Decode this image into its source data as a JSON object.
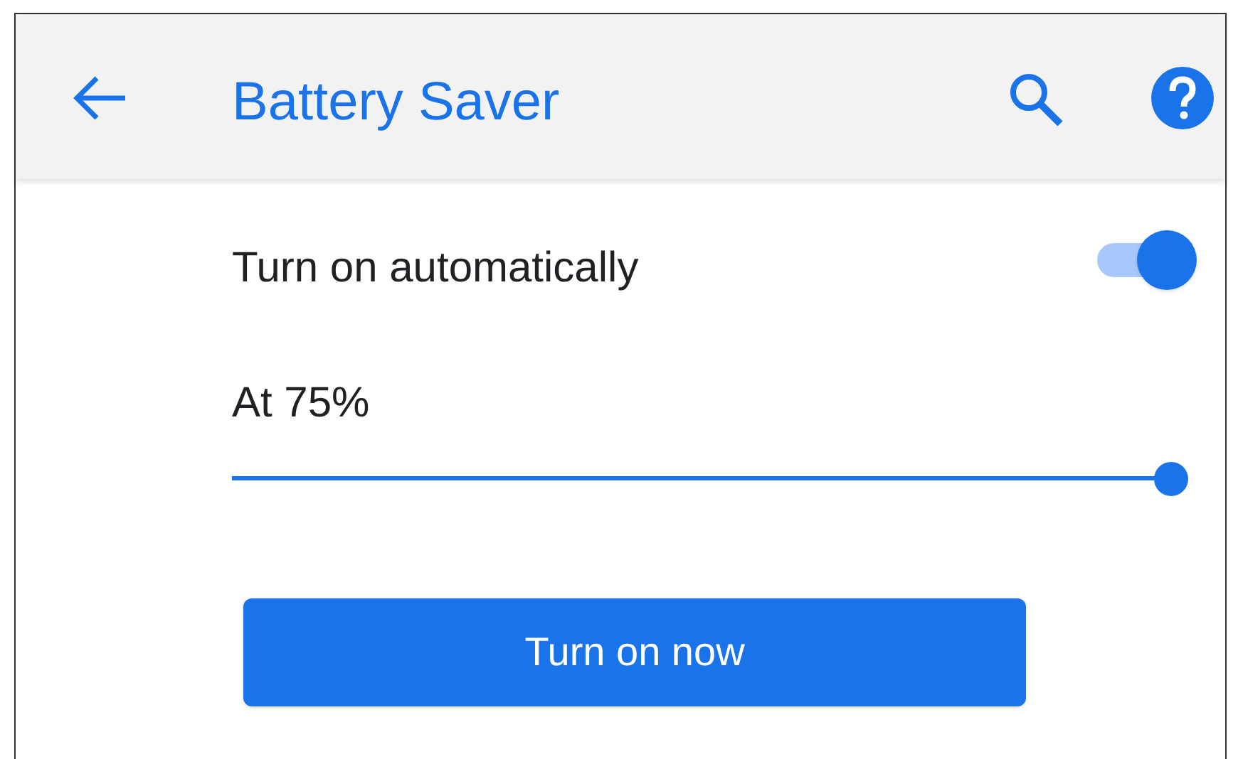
{
  "app_bar": {
    "title": "Battery Saver"
  },
  "auto_setting": {
    "label": "Turn on automatically",
    "on": true
  },
  "threshold": {
    "label": "At 75%",
    "level": 1
  },
  "button": {
    "label": "Turn on now"
  }
}
